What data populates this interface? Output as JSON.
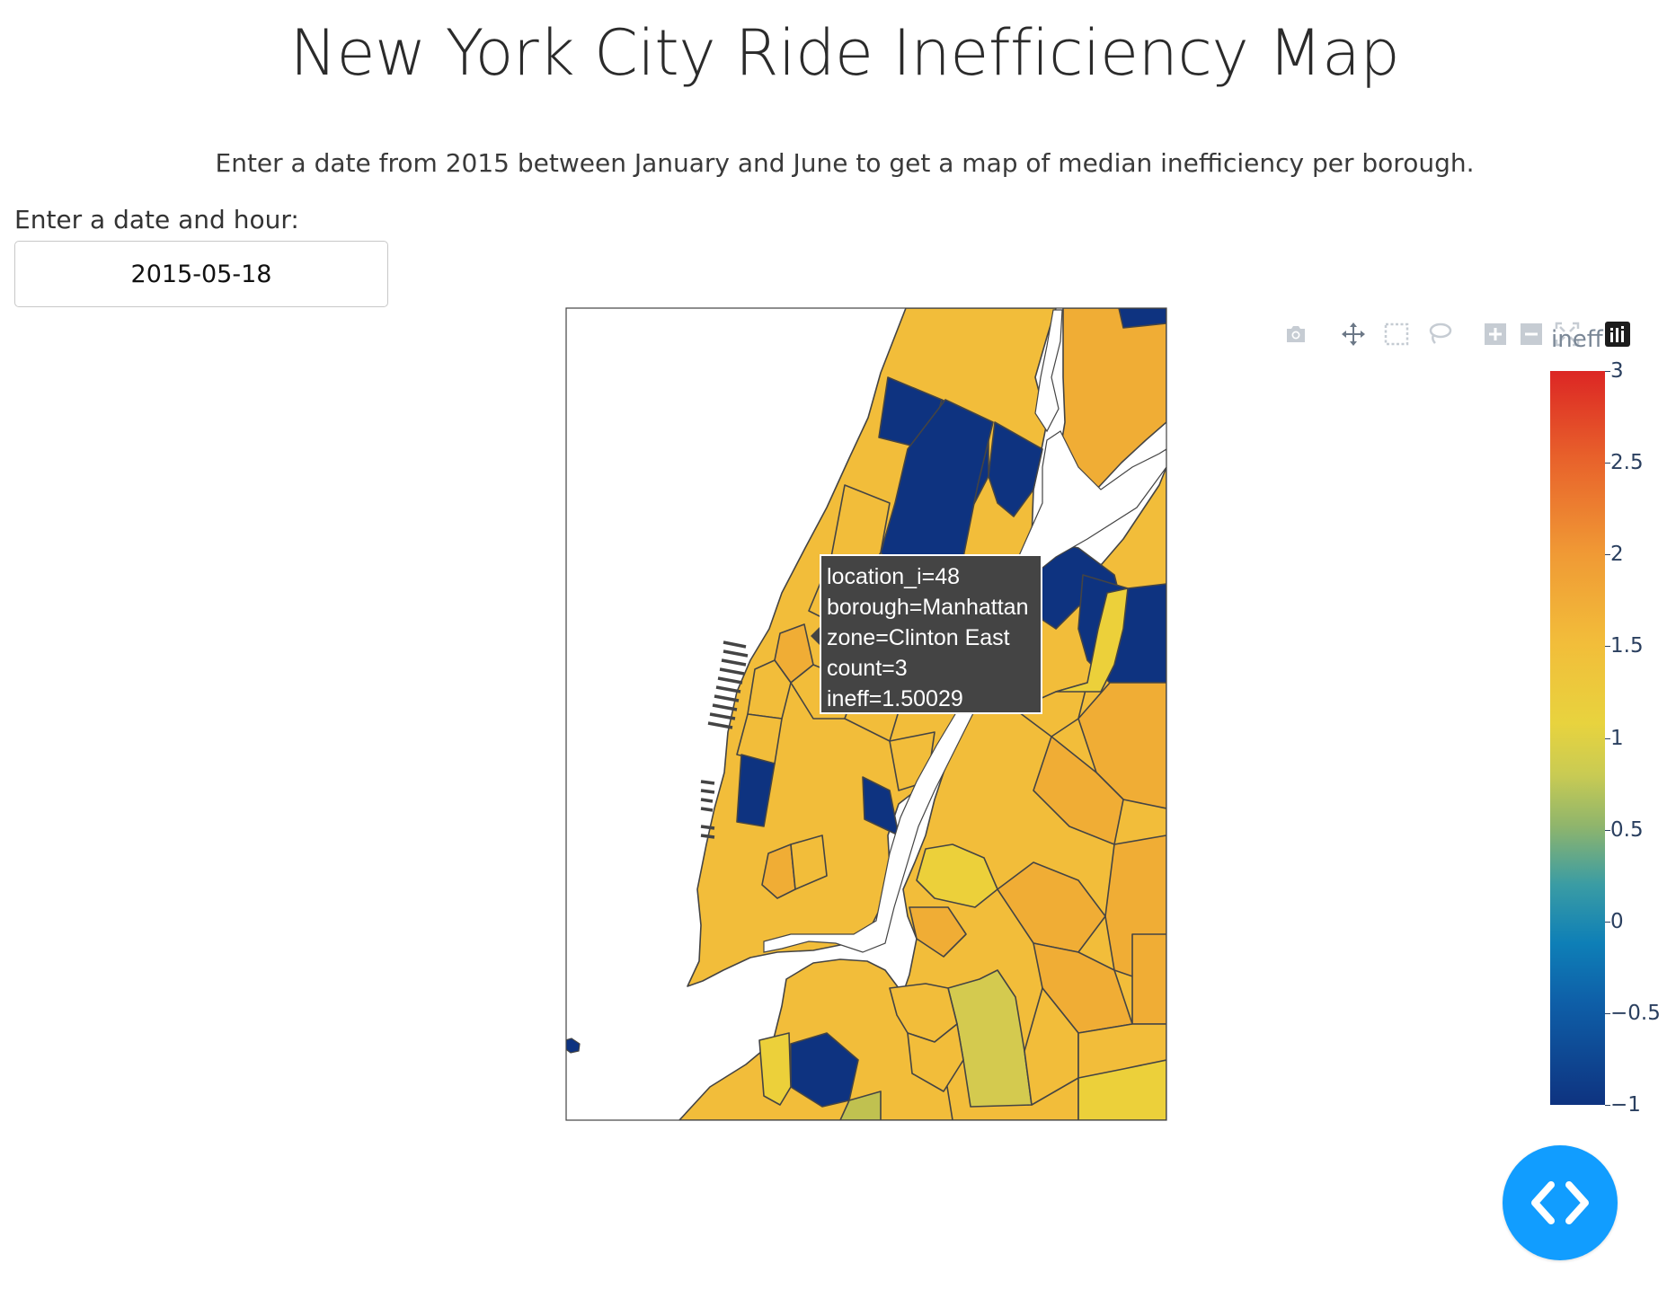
{
  "page": {
    "title": "New York City Ride Inefficiency Map",
    "subtitle": "Enter a date from 2015 between January and June to get a map of median inefficiency per borough."
  },
  "date_control": {
    "label": "Enter a date and hour:",
    "value": "2015-05-18"
  },
  "modebar": {
    "buttons": [
      {
        "name": "download-plot-camera-icon"
      },
      {
        "name": "pan-icon"
      },
      {
        "name": "box-select-icon"
      },
      {
        "name": "lasso-select-icon"
      },
      {
        "name": "zoom-in-icon"
      },
      {
        "name": "zoom-out-icon"
      },
      {
        "name": "reset-view-icon"
      },
      {
        "name": "plotly-logo-icon"
      }
    ]
  },
  "tooltip": {
    "lines": [
      "location_i=48",
      "borough=Manhattan",
      "zone=Clinton East",
      "count=3",
      "ineff=1.50029"
    ]
  },
  "colorbar": {
    "title": "ineff",
    "range": [
      -1,
      3
    ],
    "ticks": [
      "3",
      "2.5",
      "2",
      "1.5",
      "1",
      "0.5",
      "0",
      "−0.5",
      "−1"
    ],
    "colors": [
      "#0e3380",
      "#0e7fb7",
      "#3a9ca4",
      "#8fb56c",
      "#c9cb53",
      "#e8d33e",
      "#f2bd3a",
      "#f09a35",
      "#dc2624"
    ]
  },
  "map": {
    "fill_colors": {
      "default": "#f2bd3a",
      "orange": "#f0ad35",
      "yellow": "#ecd03a",
      "olive": "#d4ca4f",
      "greenish": "#c0c150",
      "navy": "#0e3380"
    }
  },
  "dev_tools": {
    "icon": "code-brackets-icon"
  }
}
